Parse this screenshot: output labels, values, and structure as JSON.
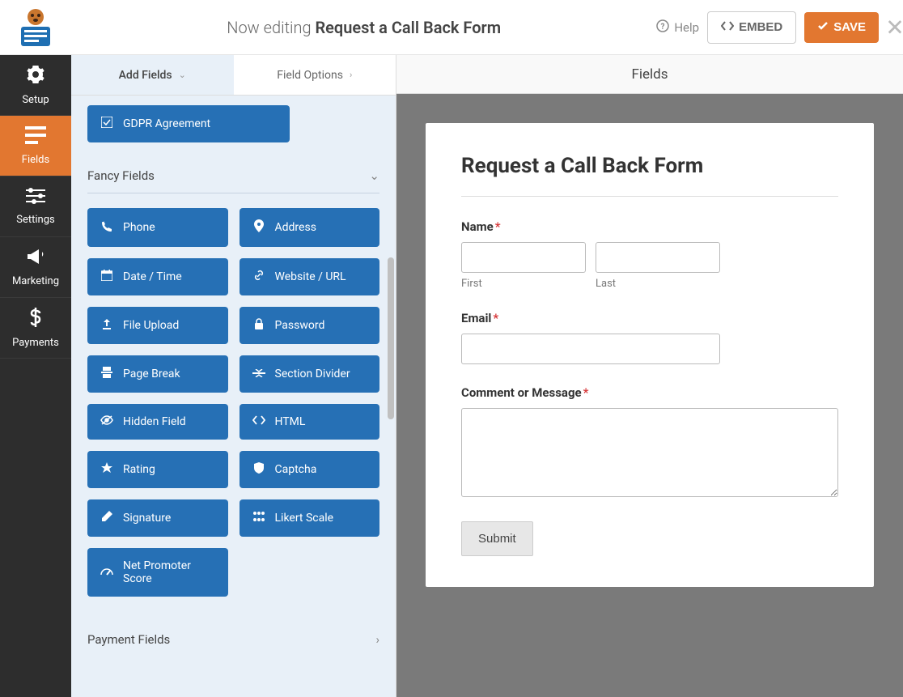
{
  "header": {
    "editing_prefix": "Now editing",
    "form_name": "Request a Call Back Form",
    "help": "Help",
    "embed": "EMBED",
    "save": "SAVE"
  },
  "sidebar": {
    "items": [
      {
        "label": "Setup",
        "icon": "gear"
      },
      {
        "label": "Fields",
        "icon": "form"
      },
      {
        "label": "Settings",
        "icon": "sliders"
      },
      {
        "label": "Marketing",
        "icon": "bullhorn"
      },
      {
        "label": "Payments",
        "icon": "dollar"
      }
    ]
  },
  "panel": {
    "header": "Fields",
    "tabs": {
      "add": "Add Fields",
      "options": "Field Options"
    },
    "gdpr": "GDPR Agreement",
    "section_fancy": "Fancy Fields",
    "fancy_fields": [
      {
        "label": "Phone",
        "icon": "phone"
      },
      {
        "label": "Address",
        "icon": "pin"
      },
      {
        "label": "Date / Time",
        "icon": "calendar"
      },
      {
        "label": "Website / URL",
        "icon": "link"
      },
      {
        "label": "File Upload",
        "icon": "upload"
      },
      {
        "label": "Password",
        "icon": "lock"
      },
      {
        "label": "Page Break",
        "icon": "pagebreak"
      },
      {
        "label": "Section Divider",
        "icon": "divider"
      },
      {
        "label": "Hidden Field",
        "icon": "eyeoff"
      },
      {
        "label": "HTML",
        "icon": "code"
      },
      {
        "label": "Rating",
        "icon": "star"
      },
      {
        "label": "Captcha",
        "icon": "shield"
      },
      {
        "label": "Signature",
        "icon": "pencil"
      },
      {
        "label": "Likert Scale",
        "icon": "grid"
      },
      {
        "label": "Net Promoter Score",
        "icon": "gauge"
      }
    ],
    "section_payment": "Payment Fields"
  },
  "preview": {
    "header": "Fields",
    "form_title": "Request a Call Back Form",
    "name_label": "Name",
    "first": "First",
    "last": "Last",
    "email_label": "Email",
    "comment_label": "Comment or Message",
    "submit": "Submit"
  }
}
